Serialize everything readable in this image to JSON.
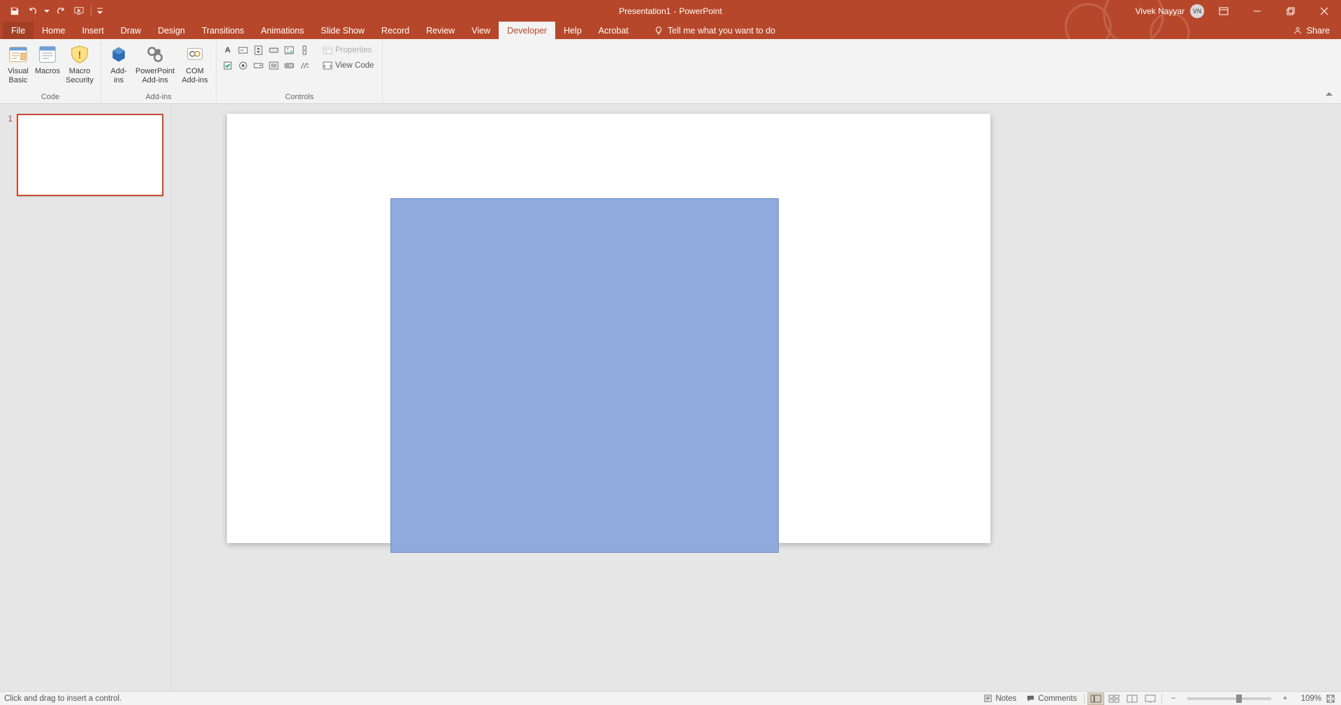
{
  "title": {
    "doc": "Presentation1",
    "sep": "  -  ",
    "app": "PowerPoint"
  },
  "user": {
    "name": "Vivek Nayyar",
    "initials": "VN"
  },
  "qat": {
    "save": "save-icon",
    "undo": "undo-icon",
    "redo": "redo-icon",
    "startfrom": "start-from-beginning-icon",
    "customize": "customize-qat-icon"
  },
  "tabs": {
    "file": "File",
    "items": [
      "Home",
      "Insert",
      "Draw",
      "Design",
      "Transitions",
      "Animations",
      "Slide Show",
      "Record",
      "Review",
      "View",
      "Developer",
      "Help",
      "Acrobat"
    ],
    "active": "Developer",
    "tellme": "Tell me what you want to do",
    "share": "Share"
  },
  "ribbon": {
    "code": {
      "label": "Code",
      "visualBasic": "Visual\nBasic",
      "macros": "Macros",
      "macroSecurity": "Macro\nSecurity"
    },
    "addins": {
      "label": "Add-ins",
      "addins": "Add-\nins",
      "ppt": "PowerPoint\nAdd-ins",
      "com": "COM\nAdd-ins"
    },
    "controls": {
      "label": "Controls",
      "properties": "Properties",
      "viewCode": "View Code"
    }
  },
  "thumbs": {
    "n1": "1"
  },
  "status": {
    "left": "Click and drag to insert a control.",
    "notes": "Notes",
    "comments": "Comments",
    "zoom": "109%"
  }
}
